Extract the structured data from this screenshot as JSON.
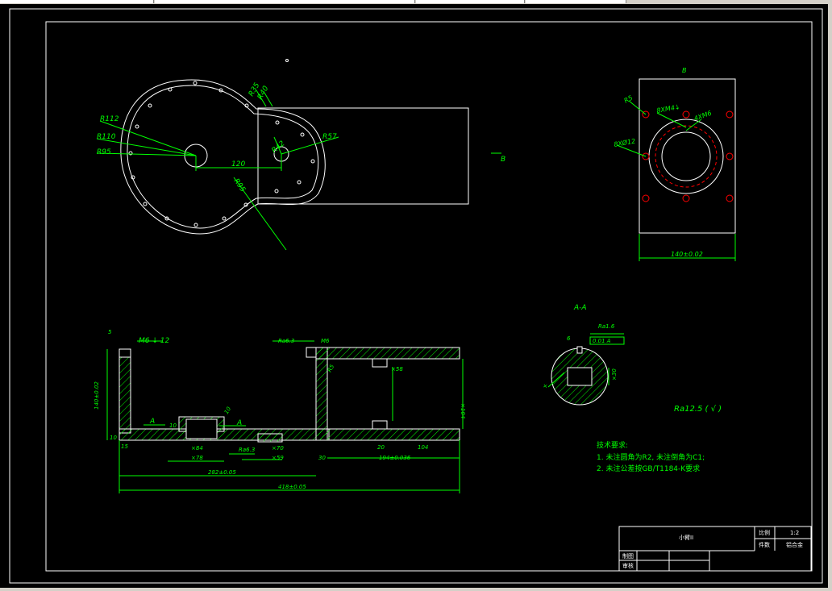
{
  "colors": {
    "background": "#000000",
    "outline": "#ffffff",
    "dimension": "#00ff00",
    "hatch": "#00ff00",
    "center": "#ff0000",
    "title": "#ffffff"
  },
  "top_view": {
    "radii": [
      "R112",
      "R110",
      "R95",
      "R35",
      "R40",
      "R42",
      "R57",
      "R95"
    ],
    "distance": "120",
    "view_arrow": "B"
  },
  "view_b": {
    "title": "B",
    "labels": [
      "R5",
      "8XM4↓",
      "4XM6",
      "8XØ12"
    ],
    "width_dim": "140±0.02"
  },
  "section_main": {
    "labels": [
      "5",
      "M6 ↓ 12",
      "Ra6.3",
      "140±0.02",
      "10",
      "15",
      "10",
      "×84",
      "×78",
      "Ra6.3",
      "×70",
      "×59",
      "282±0.05",
      "30",
      "20",
      "194±0.036",
      "104",
      "×58",
      "×104",
      "418±0.05",
      "M6",
      "10",
      "R5",
      "A",
      "A"
    ]
  },
  "section_aa": {
    "title": "A-A",
    "labels": [
      "Ra1.6",
      "0.01 A",
      "6",
      "×30",
      "×"
    ]
  },
  "roughness_note": "Ra12.5 ( √ )",
  "notes": {
    "title": "技术要求:",
    "items": [
      "1. 未注圆角为R2, 未注倒角为C1;",
      "2. 未注公差按GB/T1184-K要求"
    ]
  },
  "title_block": {
    "name": "小臂II",
    "scale_label": "比例",
    "scale_value": "1:2",
    "qty_label": "件数",
    "material": "铝合金",
    "drawn_label": "制图",
    "checked_label": "审核"
  }
}
